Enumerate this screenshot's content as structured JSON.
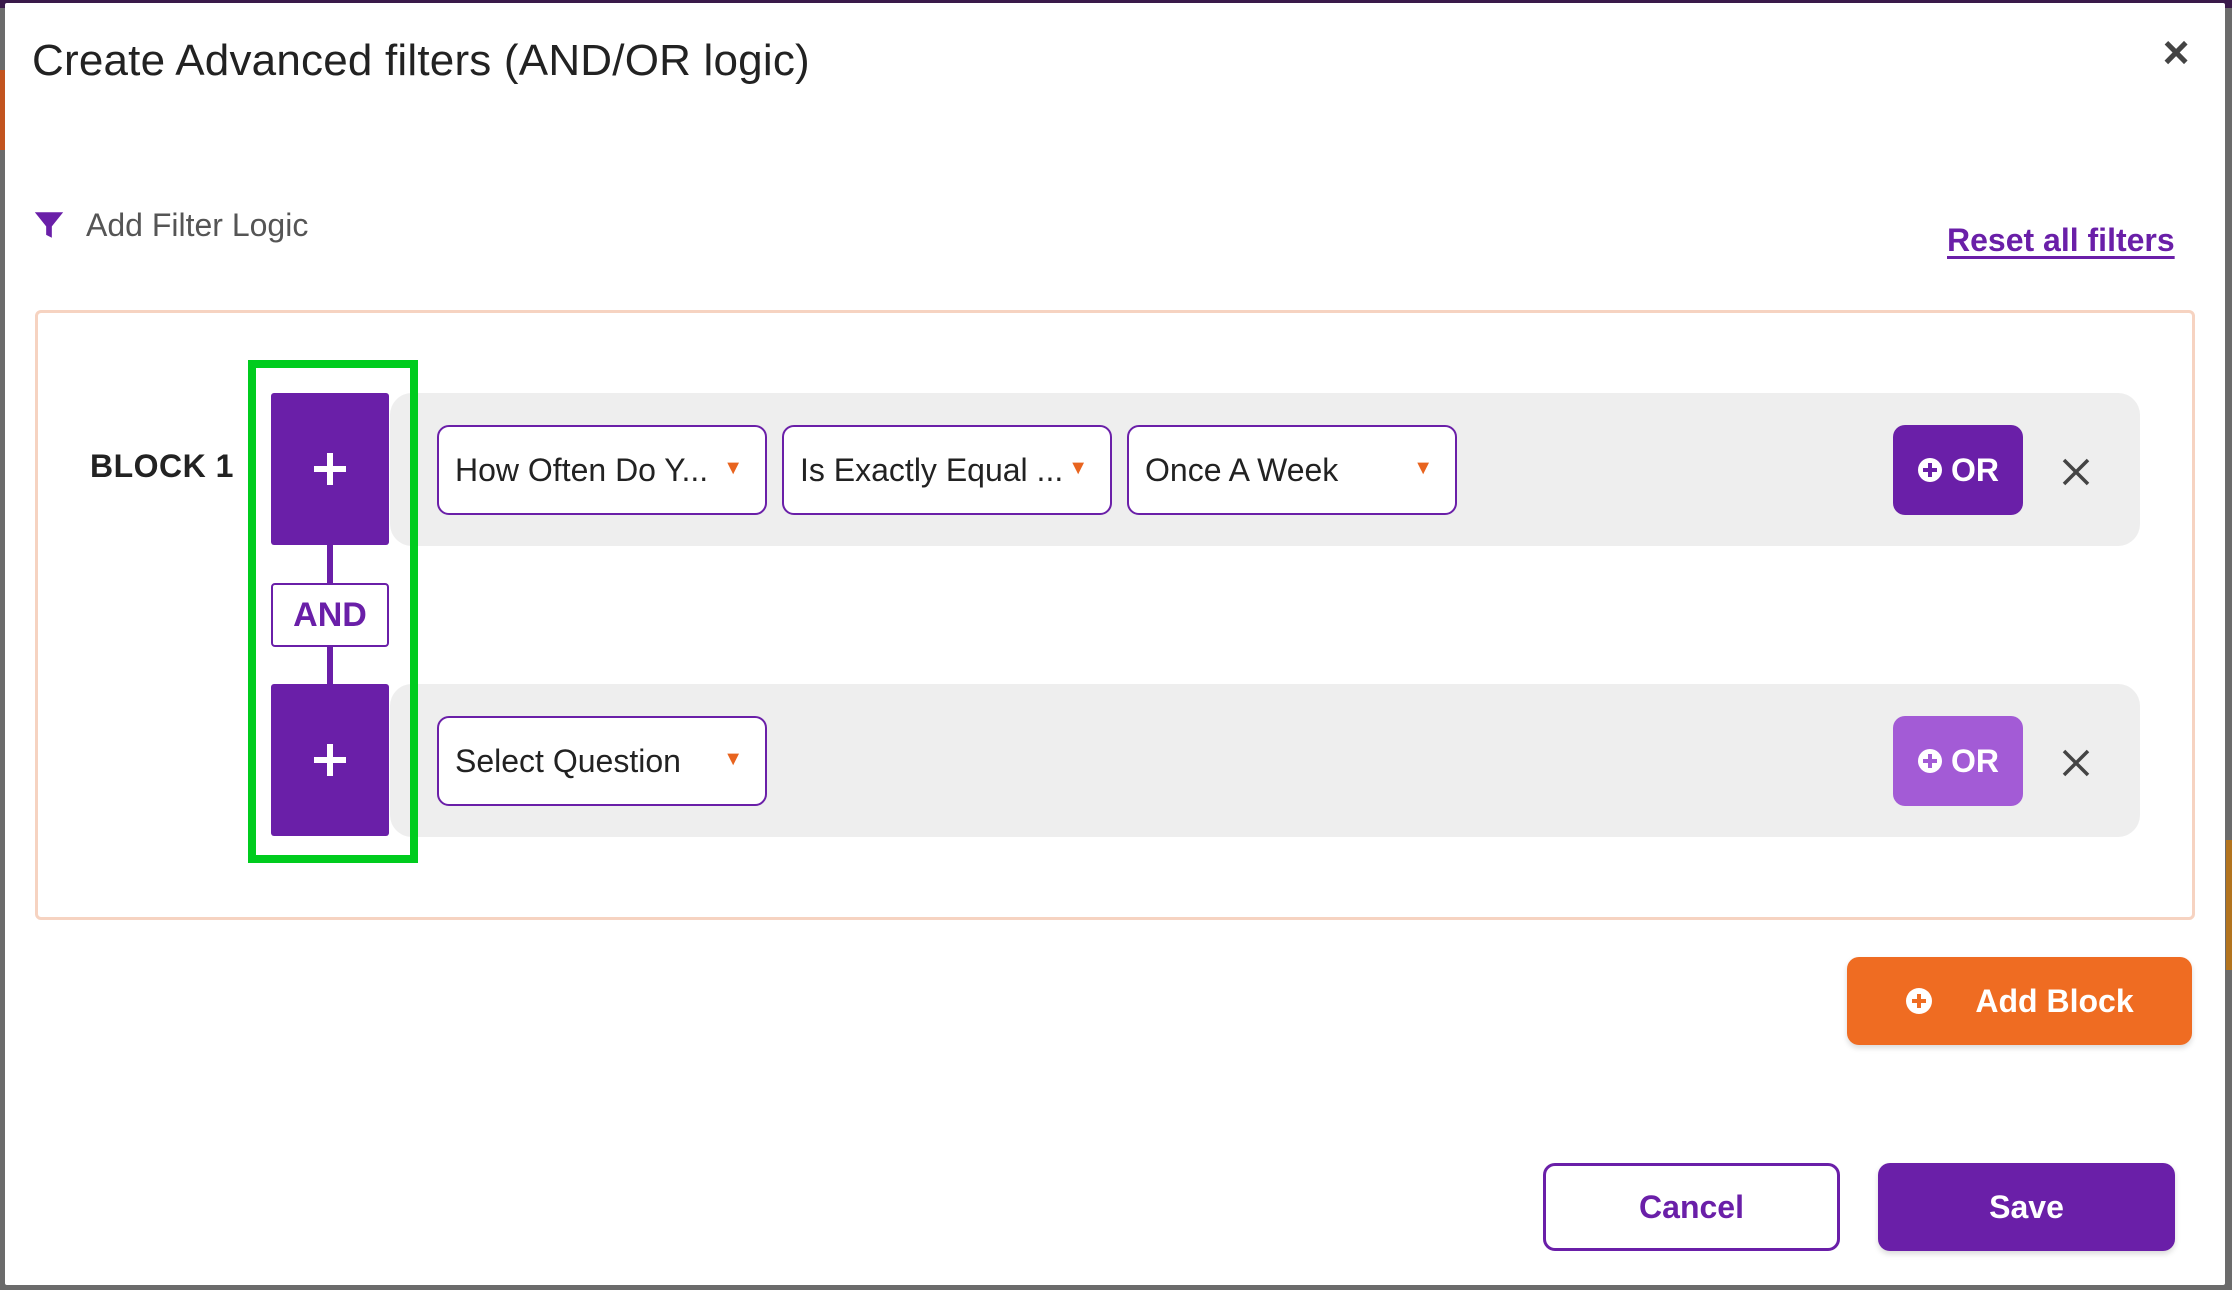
{
  "modal": {
    "title": "Create Advanced filters (AND/OR logic)",
    "close_icon": "close-icon"
  },
  "filter_header": {
    "label": "Add Filter Logic",
    "icon": "filter-funnel-icon",
    "reset_label": "Reset all filters"
  },
  "block": {
    "label": "BLOCK 1",
    "connector_label": "AND",
    "rows": [
      {
        "add_icon": "plus-icon",
        "question": "How Often Do Y...",
        "operator": "Is Exactly Equal ...",
        "value": "Once A Week",
        "or_label": "OR",
        "or_enabled": true
      },
      {
        "add_icon": "plus-icon",
        "question": "Select Question",
        "or_label": "OR",
        "or_enabled": false
      }
    ]
  },
  "actions": {
    "add_block_label": "Add Block",
    "cancel_label": "Cancel",
    "save_label": "Save"
  },
  "colors": {
    "primary": "#6a1fa8",
    "primary_disabled": "#a35bd6",
    "accent": "#ef6c22",
    "highlight": "#00cc1e",
    "block_border": "#f6d3c1",
    "row_bg": "#eeeeee"
  }
}
